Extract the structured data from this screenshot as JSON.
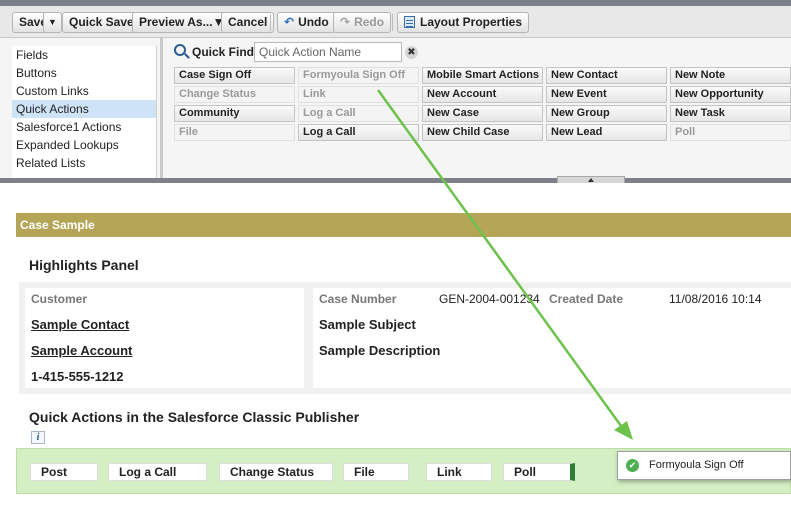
{
  "toolbar": {
    "save": "Save",
    "save_menu": "▼",
    "quick_save": "Quick Save",
    "preview_as": "Preview As...▼",
    "cancel": "Cancel",
    "undo": "Undo",
    "redo": "Redo",
    "layout_properties": "Layout Properties"
  },
  "palette": {
    "categories": [
      {
        "label": "Fields"
      },
      {
        "label": "Buttons"
      },
      {
        "label": "Custom Links"
      },
      {
        "label": "Quick Actions",
        "selected": true
      },
      {
        "label": "Salesforce1 Actions"
      },
      {
        "label": "Expanded Lookups"
      },
      {
        "label": "Related Lists"
      }
    ],
    "quick_find_label": "Quick Find",
    "quick_find_placeholder": "Quick Action Name",
    "clear_glyph": "✖",
    "actions": [
      [
        "Case Sign Off",
        "Formyoula Sign Off",
        "Mobile Smart Actions",
        "New Contact",
        "New Note"
      ],
      [
        "Change Status",
        "Link",
        "New Account",
        "New Event",
        "New Opportunity"
      ],
      [
        "Community",
        "Log a Call",
        "New Case",
        "New Group",
        "New Task"
      ],
      [
        "File",
        "Log a Call",
        "New Child Case",
        "New Lead",
        "Poll"
      ]
    ],
    "used_actions": [
      [
        false,
        true,
        false,
        false,
        false
      ],
      [
        true,
        true,
        false,
        false,
        false
      ],
      [
        false,
        true,
        false,
        false,
        false
      ],
      [
        true,
        false,
        false,
        false,
        true
      ]
    ]
  },
  "layout": {
    "section_title": "Case Sample",
    "highlights_title": "Highlights Panel",
    "left_fields": {
      "customer_label": "Customer",
      "contact": "Sample Contact",
      "account": "Sample Account",
      "phone": "1-415-555-1212"
    },
    "right_fields": {
      "case_number_label": "Case Number",
      "case_number_value": "GEN-2004-001234",
      "created_date_label": "Created Date",
      "created_date_value": "11/08/2016 10:14",
      "subject": "Sample Subject",
      "description": "Sample Description"
    },
    "publisher_title": "Quick Actions in the Salesforce Classic Publisher",
    "info_glyph": "i",
    "publisher_actions": [
      "Post",
      "Log a Call",
      "Change Status",
      "File",
      "Link",
      "Poll"
    ]
  },
  "drag_tooltip": {
    "label": "Formyoula Sign Off",
    "check_glyph": "✔"
  },
  "colors": {
    "section_bar": "#b5a556",
    "publisher_bg": "#d5efc4",
    "arrow": "#6cc24a",
    "selected_category": "#cfe3f6"
  }
}
